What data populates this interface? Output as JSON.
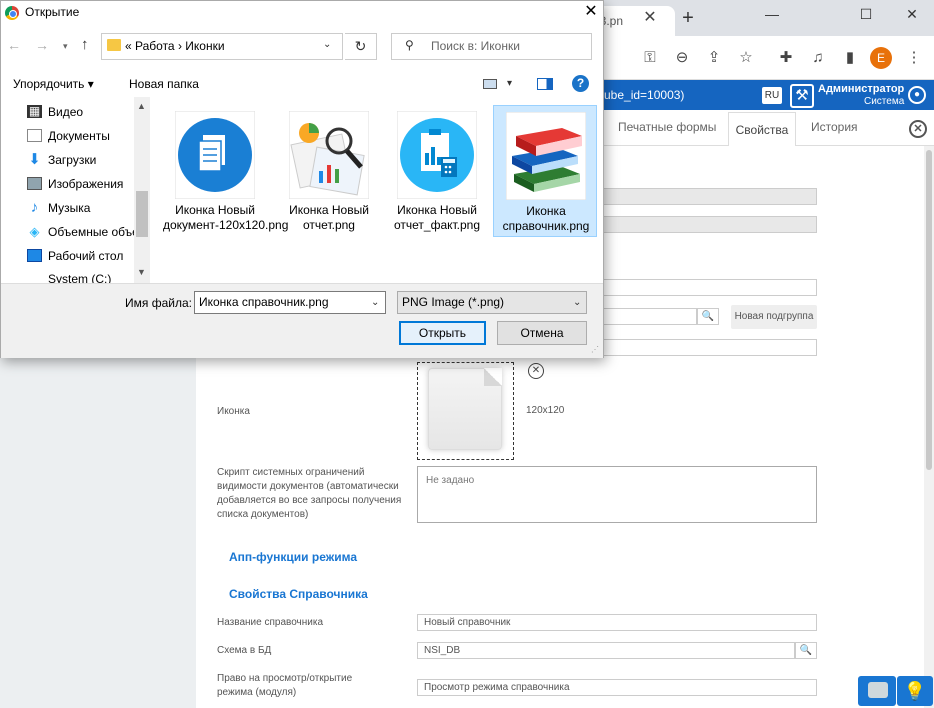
{
  "browser": {
    "tab_fragment": "53.pn",
    "tab_close": "✕",
    "new_tab": "+",
    "min": "—",
    "max": "☐",
    "close": "✕",
    "profile_initial": "E"
  },
  "app": {
    "url_fragment": "ube_id=10003)",
    "lang": "RU",
    "admin_name": "Администратор",
    "admin_role": "Система",
    "tabs": {
      "print_forms": "Печатные формы",
      "properties": "Свойства",
      "history": "История"
    },
    "new_subgroup": "Новая подгруппа",
    "icon_label": "Иконка",
    "icon_size": "120x120",
    "script_label": "Скрипт системных ограничений видимости документов (автоматически добавляется во все запросы получения списка документов)",
    "script_placeholder": "Не задано",
    "section_app_functions": "Апп-функции режима",
    "section_ref_props": "Свойства Справочника",
    "ref_name_label": "Название справочника",
    "ref_name_value": "Новый справочник",
    "db_schema_label": "Схема в БД",
    "db_schema_value": "NSI_DB",
    "view_right_label": "Право на просмотр/открытие режима (модуля)",
    "view_right_value": "Просмотр режима справочника"
  },
  "dialog": {
    "title": "Открытие",
    "close": "✕",
    "path": "«  Работа  ›  Иконки",
    "search_placeholder": "Поиск в: Иконки",
    "organize": "Упорядочить ▾",
    "new_folder": "Новая папка",
    "help": "?",
    "nav_items": [
      {
        "label": "Видео",
        "icon": "video-icon"
      },
      {
        "label": "Документы",
        "icon": "documents-icon"
      },
      {
        "label": "Загрузки",
        "icon": "downloads-icon"
      },
      {
        "label": "Изображения",
        "icon": "images-icon"
      },
      {
        "label": "Музыка",
        "icon": "music-icon"
      },
      {
        "label": "Объемные объекты",
        "icon": "3d-objects-icon"
      },
      {
        "label": "Рабочий стол",
        "icon": "desktop-icon"
      },
      {
        "label": "System (C:)",
        "icon": "drive-icon"
      }
    ],
    "files": [
      {
        "label": "Иконка Новый документ-120x120.png",
        "icon": "document-thumbnail",
        "selected": false
      },
      {
        "label": "Иконка Новый отчет.png",
        "icon": "report-thumbnail",
        "selected": false
      },
      {
        "label": "Иконка Новый отчет_факт.png",
        "icon": "report-fact-thumbnail",
        "selected": false
      },
      {
        "label": "Иконка справочник.png",
        "icon": "books-thumbnail",
        "selected": true
      }
    ],
    "filename_label": "Имя файла:",
    "filename_value": "Иконка справочник.png",
    "filetype_value": "PNG Image (*.png)",
    "open_button": "Открыть",
    "cancel_button": "Отмена"
  }
}
